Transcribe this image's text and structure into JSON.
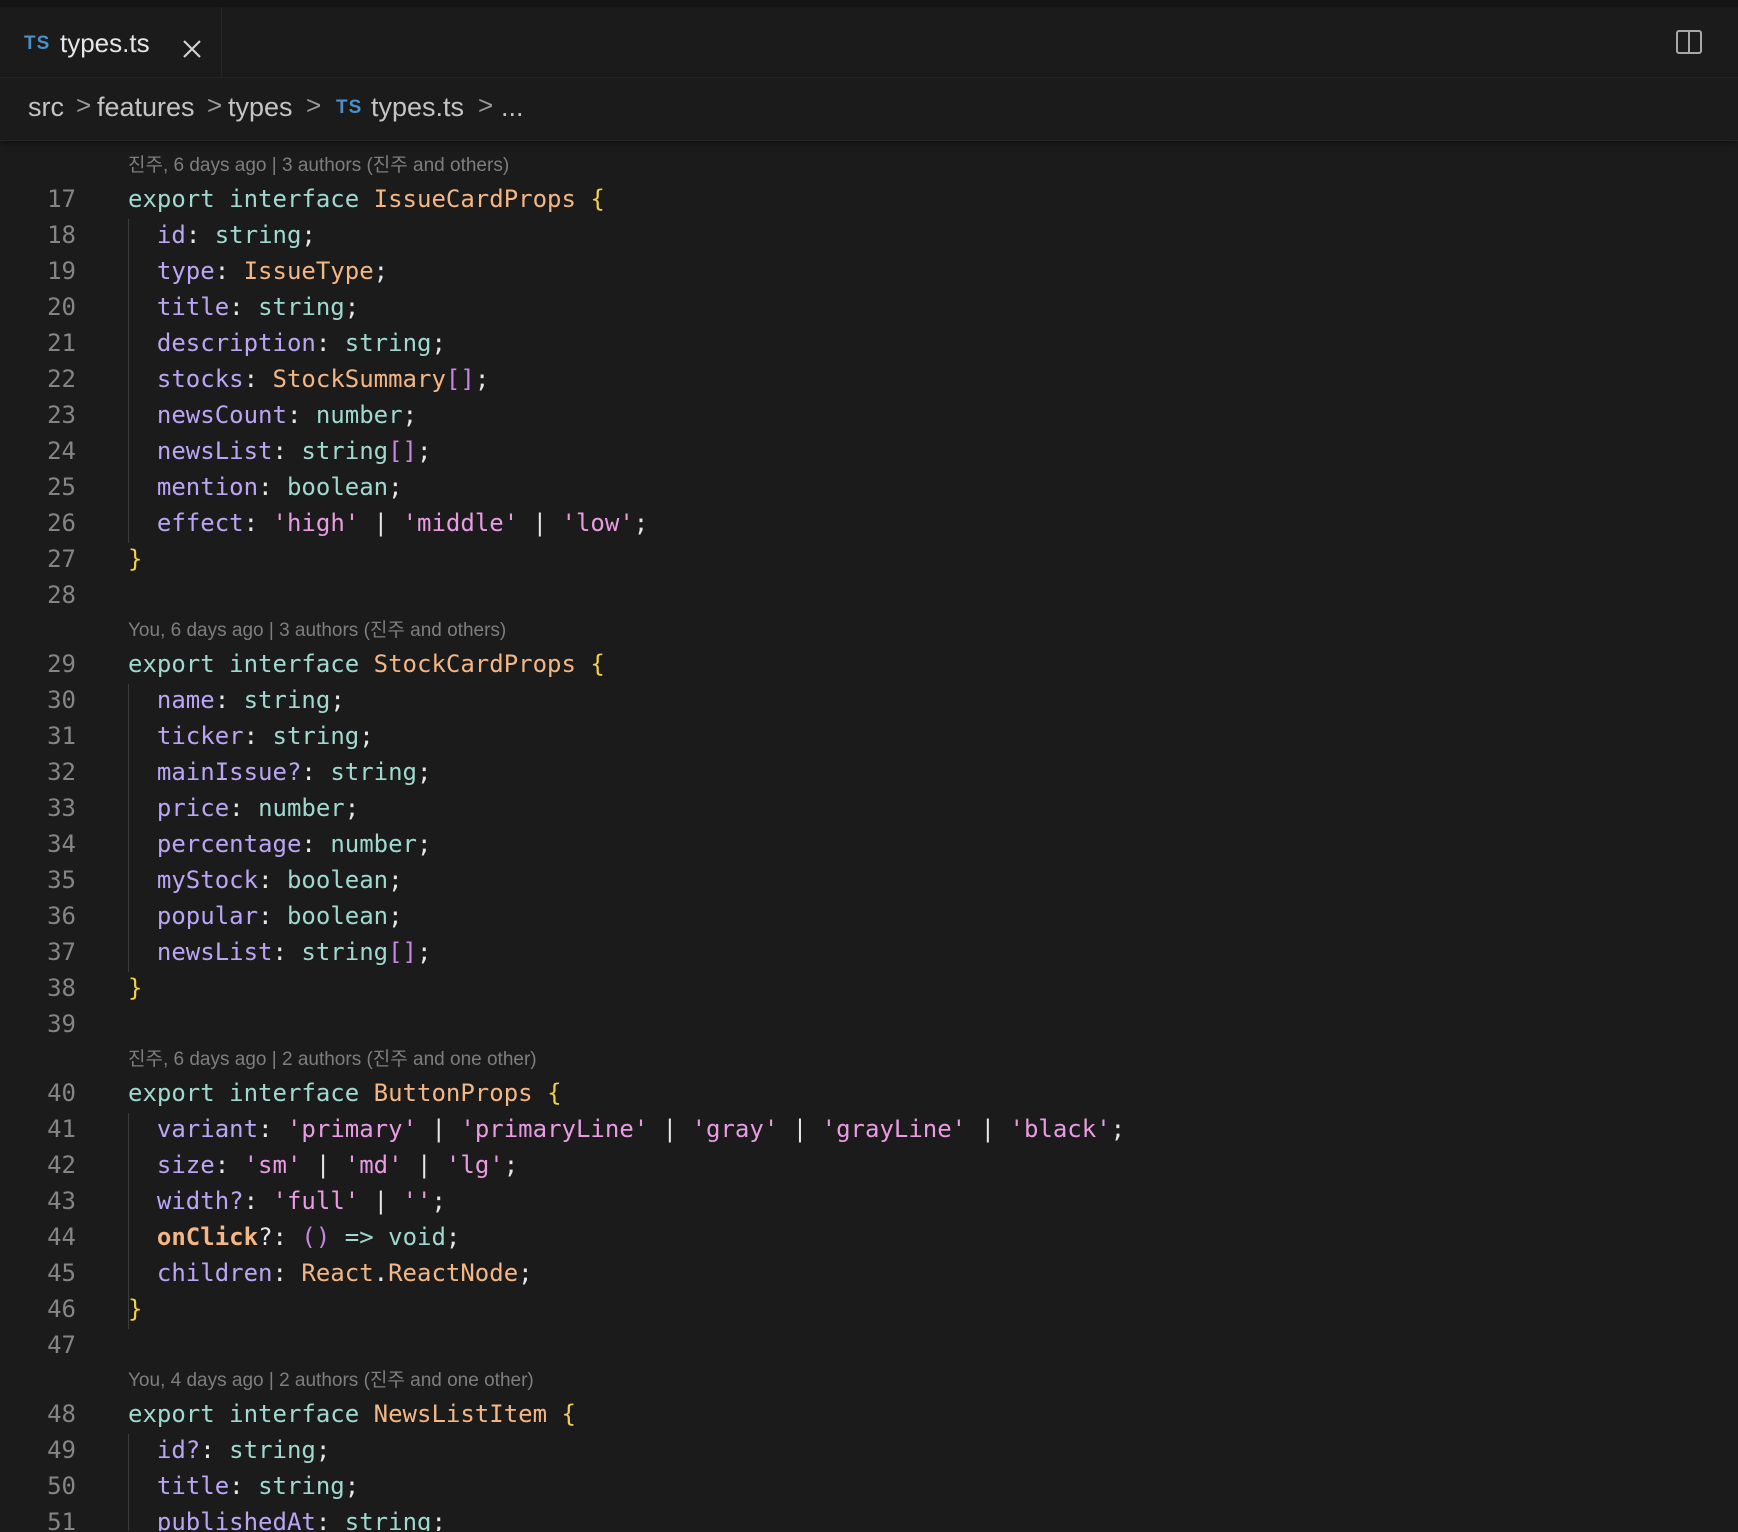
{
  "tab": {
    "badge": "TS",
    "filename": "types.ts",
    "close_icon": "close-icon"
  },
  "split_icon": "split-editor-icon",
  "breadcrumb": {
    "items": [
      "src",
      "features",
      "types",
      "types.ts",
      "..."
    ],
    "separator": ">",
    "badge": "TS"
  },
  "colors": {
    "background": "#1b1b1b",
    "keyword": "#9fd9d0",
    "type": "#f3b684",
    "brace": "#f2d04a",
    "property": "#bba5f5",
    "string": "#ea9be3",
    "line_number": "#858585",
    "lens": "#7e7e7e"
  },
  "editor": {
    "lenses": [
      "진주, 6 days ago | 3 authors (진주 and others)",
      "You, 6 days ago | 3 authors (진주 and others)",
      "진주, 6 days ago | 2 authors (진주 and one other)",
      "You, 4 days ago | 2 authors (진주 and one other)"
    ],
    "lines": [
      {
        "n": "17",
        "tokens": [
          [
            "export ",
            "kw"
          ],
          [
            "interface ",
            "kw"
          ],
          [
            "IssueCardProps",
            "type"
          ],
          [
            " ",
            "punct"
          ],
          [
            "{",
            "brace"
          ]
        ]
      },
      {
        "n": "18",
        "tokens": [
          [
            "  ",
            "punct"
          ],
          [
            "id",
            "prop"
          ],
          [
            ": ",
            "punct"
          ],
          [
            "string",
            "prim"
          ],
          [
            ";",
            "punct"
          ]
        ]
      },
      {
        "n": "19",
        "tokens": [
          [
            "  ",
            "punct"
          ],
          [
            "type",
            "prop"
          ],
          [
            ": ",
            "punct"
          ],
          [
            "IssueType",
            "type"
          ],
          [
            ";",
            "punct"
          ]
        ]
      },
      {
        "n": "20",
        "tokens": [
          [
            "  ",
            "punct"
          ],
          [
            "title",
            "prop"
          ],
          [
            ": ",
            "punct"
          ],
          [
            "string",
            "prim"
          ],
          [
            ";",
            "punct"
          ]
        ]
      },
      {
        "n": "21",
        "tokens": [
          [
            "  ",
            "punct"
          ],
          [
            "description",
            "prop"
          ],
          [
            ": ",
            "punct"
          ],
          [
            "string",
            "prim"
          ],
          [
            ";",
            "punct"
          ]
        ]
      },
      {
        "n": "22",
        "tokens": [
          [
            "  ",
            "punct"
          ],
          [
            "stocks",
            "prop"
          ],
          [
            ": ",
            "punct"
          ],
          [
            "StockSummary",
            "type"
          ],
          [
            "[]",
            "bracket"
          ],
          [
            ";",
            "punct"
          ]
        ]
      },
      {
        "n": "23",
        "tokens": [
          [
            "  ",
            "punct"
          ],
          [
            "newsCount",
            "prop"
          ],
          [
            ": ",
            "punct"
          ],
          [
            "number",
            "prim"
          ],
          [
            ";",
            "punct"
          ]
        ]
      },
      {
        "n": "24",
        "tokens": [
          [
            "  ",
            "punct"
          ],
          [
            "newsList",
            "prop"
          ],
          [
            ": ",
            "punct"
          ],
          [
            "string",
            "prim"
          ],
          [
            "[]",
            "bracket"
          ],
          [
            ";",
            "punct"
          ]
        ]
      },
      {
        "n": "25",
        "tokens": [
          [
            "  ",
            "punct"
          ],
          [
            "mention",
            "prop"
          ],
          [
            ": ",
            "punct"
          ],
          [
            "boolean",
            "prim"
          ],
          [
            ";",
            "punct"
          ]
        ]
      },
      {
        "n": "26",
        "tokens": [
          [
            "  ",
            "punct"
          ],
          [
            "effect",
            "prop"
          ],
          [
            ": ",
            "punct"
          ],
          [
            "'high'",
            "str"
          ],
          [
            " | ",
            "punct"
          ],
          [
            "'middle'",
            "str"
          ],
          [
            " | ",
            "punct"
          ],
          [
            "'low'",
            "str"
          ],
          [
            ";",
            "punct"
          ]
        ]
      },
      {
        "n": "27",
        "tokens": [
          [
            "}",
            "brace"
          ]
        ]
      },
      {
        "n": "28",
        "tokens": []
      },
      {
        "n": "29",
        "tokens": [
          [
            "export ",
            "kw"
          ],
          [
            "interface ",
            "kw"
          ],
          [
            "StockCardProps",
            "type"
          ],
          [
            " ",
            "punct"
          ],
          [
            "{",
            "brace"
          ]
        ]
      },
      {
        "n": "30",
        "tokens": [
          [
            "  ",
            "punct"
          ],
          [
            "name",
            "prop"
          ],
          [
            ": ",
            "punct"
          ],
          [
            "string",
            "prim"
          ],
          [
            ";",
            "punct"
          ]
        ]
      },
      {
        "n": "31",
        "tokens": [
          [
            "  ",
            "punct"
          ],
          [
            "ticker",
            "prop"
          ],
          [
            ": ",
            "punct"
          ],
          [
            "string",
            "prim"
          ],
          [
            ";",
            "punct"
          ]
        ]
      },
      {
        "n": "32",
        "tokens": [
          [
            "  ",
            "punct"
          ],
          [
            "mainIssue?",
            "prop"
          ],
          [
            ": ",
            "punct"
          ],
          [
            "string",
            "prim"
          ],
          [
            ";",
            "punct"
          ]
        ]
      },
      {
        "n": "33",
        "tokens": [
          [
            "  ",
            "punct"
          ],
          [
            "price",
            "prop"
          ],
          [
            ": ",
            "punct"
          ],
          [
            "number",
            "prim"
          ],
          [
            ";",
            "punct"
          ]
        ]
      },
      {
        "n": "34",
        "tokens": [
          [
            "  ",
            "punct"
          ],
          [
            "percentage",
            "prop"
          ],
          [
            ": ",
            "punct"
          ],
          [
            "number",
            "prim"
          ],
          [
            ";",
            "punct"
          ]
        ]
      },
      {
        "n": "35",
        "tokens": [
          [
            "  ",
            "punct"
          ],
          [
            "myStock",
            "prop"
          ],
          [
            ": ",
            "punct"
          ],
          [
            "boolean",
            "prim"
          ],
          [
            ";",
            "punct"
          ]
        ]
      },
      {
        "n": "36",
        "tokens": [
          [
            "  ",
            "punct"
          ],
          [
            "popular",
            "prop"
          ],
          [
            ": ",
            "punct"
          ],
          [
            "boolean",
            "prim"
          ],
          [
            ";",
            "punct"
          ]
        ]
      },
      {
        "n": "37",
        "tokens": [
          [
            "  ",
            "punct"
          ],
          [
            "newsList",
            "prop"
          ],
          [
            ": ",
            "punct"
          ],
          [
            "string",
            "prim"
          ],
          [
            "[]",
            "bracket"
          ],
          [
            ";",
            "punct"
          ]
        ]
      },
      {
        "n": "38",
        "tokens": [
          [
            "}",
            "brace"
          ]
        ]
      },
      {
        "n": "39",
        "tokens": []
      },
      {
        "n": "40",
        "tokens": [
          [
            "export ",
            "kw"
          ],
          [
            "interface ",
            "kw"
          ],
          [
            "ButtonProps",
            "type"
          ],
          [
            " ",
            "punct"
          ],
          [
            "{",
            "brace"
          ]
        ]
      },
      {
        "n": "41",
        "tokens": [
          [
            "  ",
            "punct"
          ],
          [
            "variant",
            "prop"
          ],
          [
            ": ",
            "punct"
          ],
          [
            "'primary'",
            "str"
          ],
          [
            " | ",
            "punct"
          ],
          [
            "'primaryLine'",
            "str"
          ],
          [
            " | ",
            "punct"
          ],
          [
            "'gray'",
            "str"
          ],
          [
            " | ",
            "punct"
          ],
          [
            "'grayLine'",
            "str"
          ],
          [
            " | ",
            "punct"
          ],
          [
            "'black'",
            "str"
          ],
          [
            ";",
            "punct"
          ]
        ]
      },
      {
        "n": "42",
        "tokens": [
          [
            "  ",
            "punct"
          ],
          [
            "size",
            "prop"
          ],
          [
            ": ",
            "punct"
          ],
          [
            "'sm'",
            "str"
          ],
          [
            " | ",
            "punct"
          ],
          [
            "'md'",
            "str"
          ],
          [
            " | ",
            "punct"
          ],
          [
            "'lg'",
            "str"
          ],
          [
            ";",
            "punct"
          ]
        ]
      },
      {
        "n": "43",
        "tokens": [
          [
            "  ",
            "punct"
          ],
          [
            "width?",
            "prop"
          ],
          [
            ": ",
            "punct"
          ],
          [
            "'full'",
            "str"
          ],
          [
            " | ",
            "punct"
          ],
          [
            "''",
            "str"
          ],
          [
            ";",
            "punct"
          ]
        ]
      },
      {
        "n": "44",
        "tokens": [
          [
            "  ",
            "punct"
          ],
          [
            "onClick",
            "method"
          ],
          [
            "?: ",
            "punct"
          ],
          [
            "()",
            "bracket"
          ],
          [
            " => ",
            "prim"
          ],
          [
            "void",
            "prim"
          ],
          [
            ";",
            "punct"
          ]
        ]
      },
      {
        "n": "45",
        "tokens": [
          [
            "  ",
            "punct"
          ],
          [
            "children",
            "prop"
          ],
          [
            ": ",
            "punct"
          ],
          [
            "React",
            "type"
          ],
          [
            ".",
            "punct"
          ],
          [
            "ReactNode",
            "type"
          ],
          [
            ";",
            "punct"
          ]
        ]
      },
      {
        "n": "46",
        "tokens": [
          [
            "}",
            "brace"
          ]
        ]
      },
      {
        "n": "47",
        "tokens": []
      },
      {
        "n": "48",
        "tokens": [
          [
            "export ",
            "kw"
          ],
          [
            "interface ",
            "kw"
          ],
          [
            "NewsListItem",
            "type"
          ],
          [
            " ",
            "punct"
          ],
          [
            "{",
            "brace"
          ]
        ]
      },
      {
        "n": "49",
        "tokens": [
          [
            "  ",
            "punct"
          ],
          [
            "id?",
            "prop"
          ],
          [
            ": ",
            "punct"
          ],
          [
            "string",
            "prim"
          ],
          [
            ";",
            "punct"
          ]
        ]
      },
      {
        "n": "50",
        "tokens": [
          [
            "  ",
            "punct"
          ],
          [
            "title",
            "prop"
          ],
          [
            ": ",
            "punct"
          ],
          [
            "string",
            "prim"
          ],
          [
            ";",
            "punct"
          ]
        ]
      },
      {
        "n": "51",
        "tokens": [
          [
            "  ",
            "punct"
          ],
          [
            "publishedAt",
            "prop"
          ],
          [
            ": ",
            "punct"
          ],
          [
            "string",
            "prim"
          ],
          [
            ";",
            "punct"
          ]
        ]
      }
    ]
  }
}
